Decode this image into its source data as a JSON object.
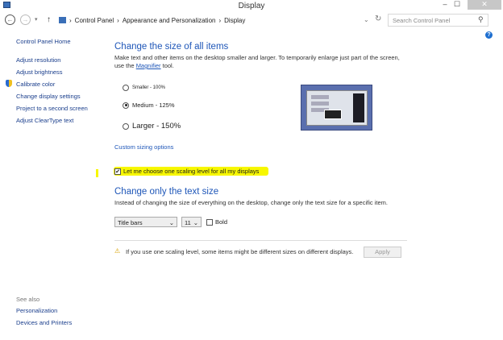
{
  "window": {
    "title": "Display",
    "minimize": "–",
    "maximize": "☐",
    "close": "✕"
  },
  "nav": {
    "back": "←",
    "forward": "→",
    "recent": "▾",
    "up": "↑",
    "breadcrumb": [
      "Control Panel",
      "Appearance and Personalization",
      "Display"
    ],
    "sep": "›",
    "dropdown": "⌄",
    "refresh": "↻",
    "search_placeholder": "Search Control Panel",
    "search_icon": "⚲",
    "help": "?"
  },
  "sidebar": {
    "home": "Control Panel Home",
    "items": [
      "Adjust resolution",
      "Adjust brightness",
      "Calibrate color",
      "Change display settings",
      "Project to a second screen",
      "Adjust ClearType text"
    ],
    "see_also": "See also",
    "see_also_items": [
      "Personalization",
      "Devices and Printers"
    ]
  },
  "main": {
    "heading1": "Change the size of all items",
    "desc1a": "Make text and other items on the desktop smaller and larger. To temporarily enlarge just part of the screen,",
    "desc1b_pre": "use the ",
    "desc1b_link": "Magnifier",
    "desc1b_post": " tool.",
    "options": [
      {
        "label": "Smaller - 100%",
        "selected": false
      },
      {
        "label": "Medium - 125%",
        "selected": true
      },
      {
        "label": "Larger - 150%",
        "selected": false
      }
    ],
    "custom": "Custom sizing options",
    "scaling_checkbox": {
      "label": "Let me choose one scaling level for all my displays",
      "checked": true
    },
    "heading2": "Change only the text size",
    "desc2": "Instead of changing the size of everything on the desktop, change only the text size for a specific item.",
    "item_select": "Title bars",
    "size_select": "11",
    "bold_label": "Bold",
    "warning": "If you use one scaling level, some items might be different sizes on different displays.",
    "apply": "Apply"
  },
  "colors": {
    "highlight": "#f7f700",
    "link": "#1e56b8"
  }
}
